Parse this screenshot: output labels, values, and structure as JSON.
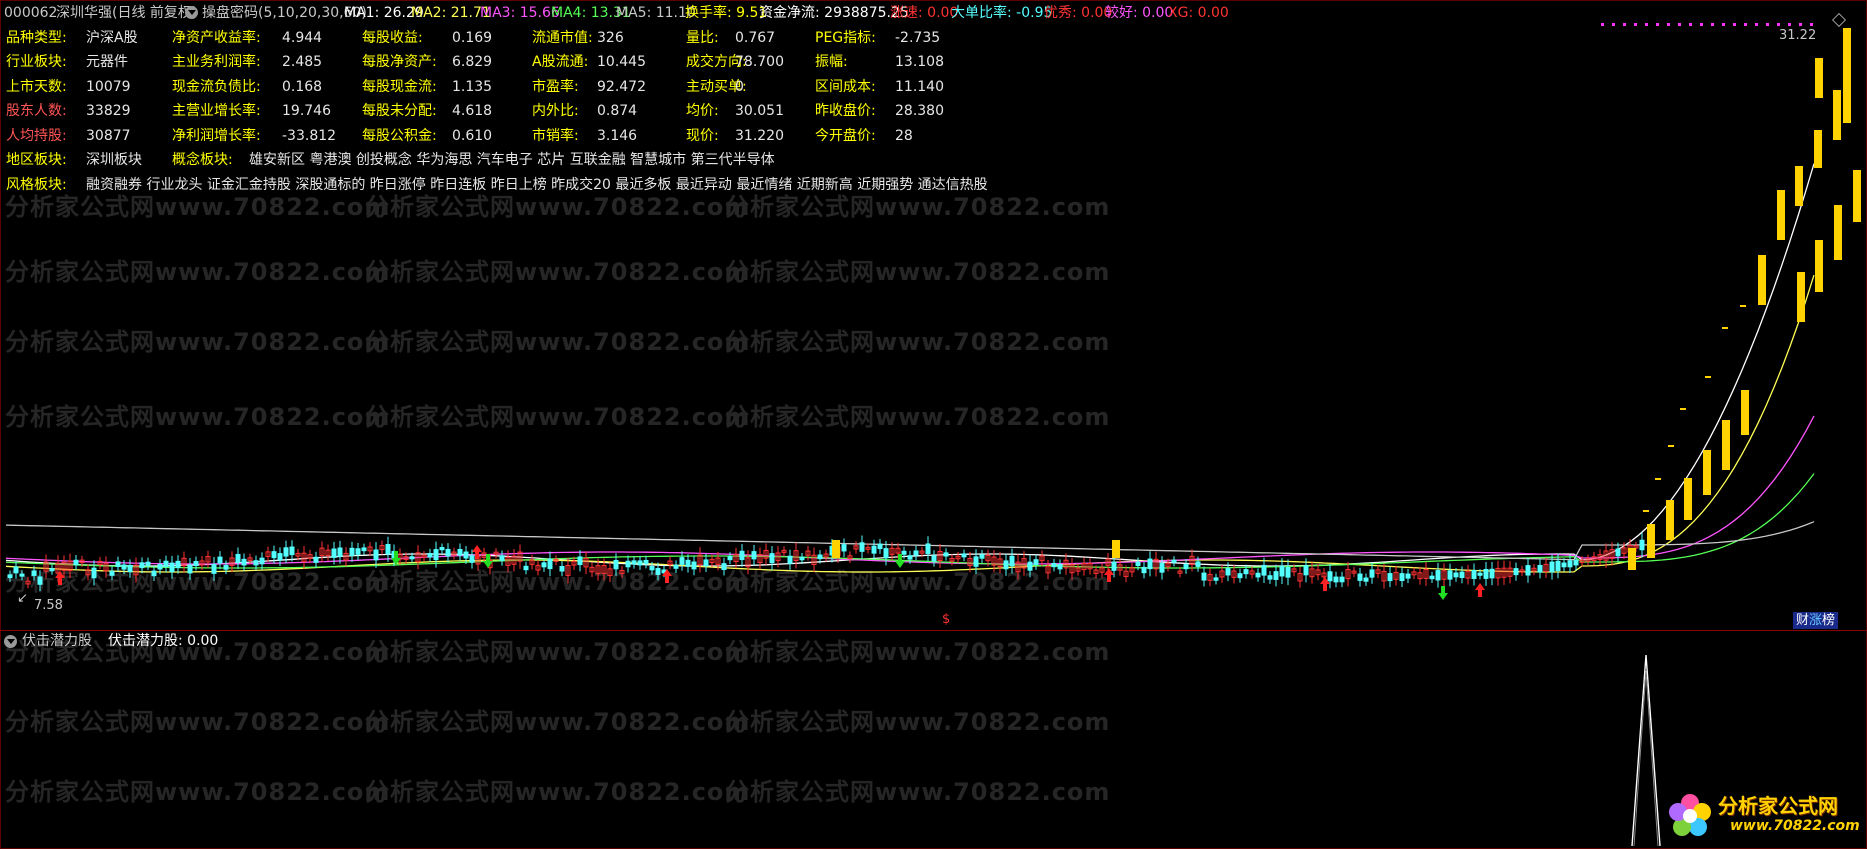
{
  "header": {
    "code": "000062",
    "name": "深圳华强(日线 前复权)",
    "indicator": "操盘密码(5,10,20,30,60)",
    "ma1_label": "MA1: 26.29",
    "ma2_label": "MA2: 21.71",
    "ma3_label": "MA3: 15.66",
    "ma4_label": "MA4: 13.31",
    "ma5_label": "MA5: 11.10",
    "turnover_label": "换手率: 9.51",
    "netflow_label": "资金净流: 2938875.25",
    "speed_label": "涨速: 0.00",
    "bigorder_label": "大单比率: -0.95",
    "excellent_label": "优秀: 0.00",
    "good_label": "较好: 0.00",
    "xg_label": "XG: 0.00",
    "colors": {
      "ma1": "#ffffff",
      "ma2": "#ffff55",
      "ma3": "#ff55ff",
      "ma4": "#55ff55",
      "ma5": "#c8c8c8",
      "turnover": "#ffff00",
      "speed": "#ff3333",
      "bigorder": "#55ffff",
      "excellent": "#ff3333",
      "good": "#ff55ff",
      "xg": "#ff3333"
    }
  },
  "info_rows": [
    [
      [
        "品种类型:",
        "沪深A股"
      ],
      [
        "净资产收益率:",
        "4.944"
      ],
      [
        "每股收益:",
        "0.169"
      ],
      [
        "流通市值:",
        "326"
      ],
      [
        "量比:",
        "0.767"
      ],
      [
        "PEG指标:",
        "-2.735"
      ]
    ],
    [
      [
        "行业板块:",
        "元器件"
      ],
      [
        "主业务利润率:",
        "2.485"
      ],
      [
        "每股净资产:",
        "6.829"
      ],
      [
        "A股流通:",
        "10.445"
      ],
      [
        "成交方向:",
        "78.700"
      ],
      [
        "振幅:",
        "13.108"
      ]
    ],
    [
      [
        "上市天数:",
        "10079"
      ],
      [
        "现金流负债比:",
        "0.168"
      ],
      [
        "每股现金流:",
        "1.135"
      ],
      [
        "市盈率:",
        "92.472"
      ],
      [
        "主动买单:",
        "0"
      ],
      [
        "区间成本:",
        "11.140"
      ]
    ],
    [
      [
        "股东人数:",
        "33829"
      ],
      [
        "主营业增长率:",
        "19.746"
      ],
      [
        "每股未分配:",
        "4.618"
      ],
      [
        "内外比:",
        "0.874"
      ],
      [
        "均价:",
        "30.051"
      ],
      [
        "昨收盘价:",
        "28.380"
      ]
    ],
    [
      [
        "人均持股:",
        "30877"
      ],
      [
        "净利润增长率:",
        "-33.812"
      ],
      [
        "每股公积金:",
        "0.610"
      ],
      [
        "市销率:",
        "3.146"
      ],
      [
        "现价:",
        "31.220"
      ],
      [
        "今开盘价:",
        "28"
      ]
    ]
  ],
  "region": {
    "label": "地区板块:",
    "value": "深圳板块"
  },
  "concept": {
    "label": "概念板块:",
    "value": "雄安新区 粤港澳 创投概念 华为海思 汽车电子 芯片 互联金融 智慧城市 第三代半导体"
  },
  "style": {
    "label": "风格板块:",
    "value": "融资融券 行业龙头 证金汇金持股 深股通标的 昨日涨停 昨日连板 昨日上榜 昨成交20 最近多板 最近异动 最近情绪 近期新高 近期强势 通达信热股"
  },
  "watermark": "分析家公式网www.70822.com",
  "price_high_label": "31.22",
  "price_low_label": "7.58",
  "dollar_marker": "$",
  "caizhang_badge": [
    "财",
    "涨",
    "榜"
  ],
  "indicator_panel": {
    "name": "伏击潜力股",
    "value_label": "伏击潜力股: 0.00"
  },
  "logo": {
    "name": "分析家公式网",
    "url": "www.70822.com"
  }
}
